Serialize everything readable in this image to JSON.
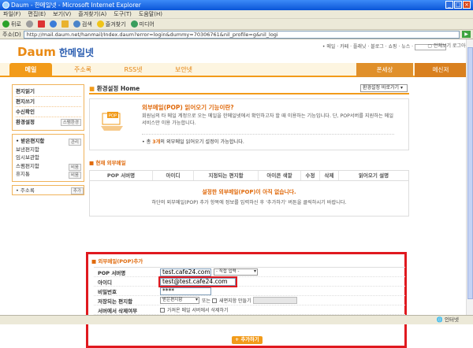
{
  "window": {
    "title": "Daum - 한메일넷 - Microsoft Internet Explorer"
  },
  "menu": [
    "파일(F)",
    "편집(E)",
    "보기(V)",
    "즐겨찾기(A)",
    "도구(T)",
    "도움말(H)"
  ],
  "toolbar": {
    "back": "뒤로",
    "search": "검색",
    "favorites": "즐겨찾기",
    "media": "미디어"
  },
  "address": {
    "label": "주소(D)",
    "url": "http://mail.daum.net/hanmail/Index.daum?error=login&dummy=70306761&nil_profile=g&nil_logi",
    "go": "▶"
  },
  "site": {
    "logo_daum": "Daum",
    "logo_service": "한메일넷",
    "top_links": "• 메일 · 카페 · 플래닛 · 블로그 · 쇼핑 · 뉴스 ·",
    "top_links2": "▢ 전체보기 로그아웃"
  },
  "tabs": [
    "메일",
    "주소록",
    "RSS넷",
    "보안넷"
  ],
  "right_tabs": [
    "폰세상",
    "메신저"
  ],
  "sidebar": {
    "items": [
      "편지읽기",
      "편지쓰기",
      "수신확인",
      "환경설정"
    ],
    "settings_btn": "스팸환경",
    "folders_title": "• 받은편지함",
    "folders_btn": "관리",
    "folders": [
      "보낸편지함",
      "임시보관함",
      "스팸편지함",
      "휴지통"
    ],
    "spam_btn": "비움",
    "trash_btn": "비움",
    "address": "• 주소록",
    "address_btn": "추가"
  },
  "main": {
    "title": "환경설정 Home",
    "select": "환경설정 바로가기",
    "info_title": "외부메일(POP) 읽어오기 기능이란?",
    "info_desc": "회원님의 타 메일 계정으로 오는 메일을 한메일넷에서 확인하고자 할 때 이용하는 기능입니다. 단, POP서버를 지원하는 메일 서비스만 이용 가능합니다.",
    "info_note_pre": "• 총 ",
    "info_note_count": "3개",
    "info_note_post": "의 외부메일 읽어오기 설정이 가능합니다.",
    "section1": "현재 외부메일",
    "table_headers": [
      "POP 서버명",
      "아이디",
      "지정되는 편지함",
      "아이콘 색깔",
      "수정",
      "삭제",
      "읽어오기 설명"
    ],
    "empty1": "설정한 외부메일(POP)이 아직 없습니다.",
    "empty2": "하단의 외부메일(POP) 추가 항목에 정보를 입력하신 후 '추가하기' 버튼을 클릭하시기 바랍니다."
  },
  "add": {
    "title": "외부메일(POP)추가",
    "labels": [
      "POP 서버명",
      "아이디",
      "비밀번호",
      "저장되는 편지함",
      "서버에서 삭제여부"
    ],
    "server_value": "test.cafe24.com",
    "server_select": "- 직접 입력 -",
    "id_value": "test@test.cafe24.com",
    "password_value": "****",
    "box_select": "받은편지함",
    "or_text": "또는",
    "new_box_text": "새편지함 만들기",
    "delete_text": "가져온 메일 서버에서 삭제하기",
    "add_button": "+ 추가하기"
  },
  "status": {
    "zone": "인터넷"
  }
}
